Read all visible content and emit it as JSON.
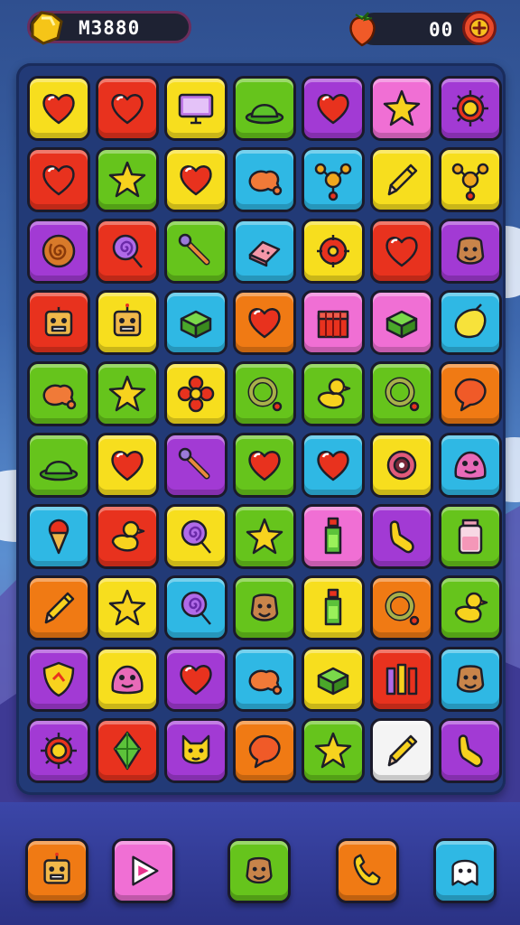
{
  "hud": {
    "score": "M3880",
    "score_icon": "gold-nugget-icon",
    "lives": "00",
    "lives_icon": "strawberry-icon",
    "add_icon": "plus-icon"
  },
  "palette": {
    "Y": "#f7de1e",
    "R": "#e8321e",
    "G": "#66c41c",
    "P": "#a23ad4",
    "K": "#f06fd4",
    "C": "#2fb8e4",
    "O": "#f07a14",
    "W": "#f4f4f4"
  },
  "board": {
    "rows": [
      [
        {
          "c": "Y",
          "icon": "heart"
        },
        {
          "c": "R",
          "icon": "heart"
        },
        {
          "c": "Y",
          "icon": "monitor"
        },
        {
          "c": "G",
          "icon": "bowler-hat"
        },
        {
          "c": "P",
          "icon": "heart"
        },
        {
          "c": "K",
          "icon": "star"
        },
        {
          "c": "P",
          "icon": "sun-badge"
        }
      ],
      [
        {
          "c": "R",
          "icon": "heart"
        },
        {
          "c": "G",
          "icon": "star"
        },
        {
          "c": "Y",
          "icon": "heart"
        },
        {
          "c": "C",
          "icon": "blob"
        },
        {
          "c": "C",
          "icon": "molecule"
        },
        {
          "c": "Y",
          "icon": "pencil"
        },
        {
          "c": "Y",
          "icon": "molecule"
        }
      ],
      [
        {
          "c": "P",
          "icon": "swirl-cookie"
        },
        {
          "c": "R",
          "icon": "lollipop"
        },
        {
          "c": "G",
          "icon": "wand"
        },
        {
          "c": "C",
          "icon": "eraser"
        },
        {
          "c": "Y",
          "icon": "gear"
        },
        {
          "c": "R",
          "icon": "heart"
        },
        {
          "c": "P",
          "icon": "face"
        }
      ],
      [
        {
          "c": "R",
          "icon": "robot"
        },
        {
          "c": "Y",
          "icon": "robot"
        },
        {
          "c": "C",
          "icon": "box"
        },
        {
          "c": "O",
          "icon": "heart"
        },
        {
          "c": "K",
          "icon": "gift"
        },
        {
          "c": "K",
          "icon": "box"
        },
        {
          "c": "C",
          "icon": "lemon"
        }
      ],
      [
        {
          "c": "G",
          "icon": "blob"
        },
        {
          "c": "G",
          "icon": "star"
        },
        {
          "c": "Y",
          "icon": "flower"
        },
        {
          "c": "G",
          "icon": "ring"
        },
        {
          "c": "G",
          "icon": "duck"
        },
        {
          "c": "G",
          "icon": "ring"
        },
        {
          "c": "O",
          "icon": "speech"
        }
      ],
      [
        {
          "c": "G",
          "icon": "bowler-hat"
        },
        {
          "c": "Y",
          "icon": "heart"
        },
        {
          "c": "P",
          "icon": "wand"
        },
        {
          "c": "G",
          "icon": "heart"
        },
        {
          "c": "C",
          "icon": "heart"
        },
        {
          "c": "Y",
          "icon": "camera"
        },
        {
          "c": "C",
          "icon": "monster"
        }
      ],
      [
        {
          "c": "C",
          "icon": "ice-cream"
        },
        {
          "c": "R",
          "icon": "duck"
        },
        {
          "c": "Y",
          "icon": "lollipop"
        },
        {
          "c": "G",
          "icon": "star"
        },
        {
          "c": "K",
          "icon": "bottle"
        },
        {
          "c": "P",
          "icon": "glove"
        },
        {
          "c": "G",
          "icon": "jar"
        }
      ],
      [
        {
          "c": "O",
          "icon": "pencil"
        },
        {
          "c": "Y",
          "icon": "star"
        },
        {
          "c": "C",
          "icon": "lollipop"
        },
        {
          "c": "G",
          "icon": "face"
        },
        {
          "c": "Y",
          "icon": "bottle"
        },
        {
          "c": "O",
          "icon": "ring"
        },
        {
          "c": "G",
          "icon": "duck"
        }
      ],
      [
        {
          "c": "P",
          "icon": "shield"
        },
        {
          "c": "Y",
          "icon": "monster"
        },
        {
          "c": "P",
          "icon": "heart"
        },
        {
          "c": "C",
          "icon": "blob"
        },
        {
          "c": "Y",
          "icon": "box"
        },
        {
          "c": "R",
          "icon": "crayons"
        },
        {
          "c": "C",
          "icon": "face"
        }
      ],
      [
        {
          "c": "P",
          "icon": "sun-badge"
        },
        {
          "c": "R",
          "icon": "gem"
        },
        {
          "c": "P",
          "icon": "cat-face"
        },
        {
          "c": "O",
          "icon": "speech"
        },
        {
          "c": "G",
          "icon": "star"
        },
        {
          "c": "W",
          "icon": "pencil"
        },
        {
          "c": "P",
          "icon": "glove"
        }
      ]
    ]
  },
  "toolbar": [
    {
      "c": "O",
      "icon": "robot"
    },
    {
      "c": "K",
      "icon": "play"
    },
    {
      "c": "G",
      "icon": "face"
    },
    {
      "c": "O",
      "icon": "phone"
    },
    {
      "c": "C",
      "icon": "ghost"
    }
  ]
}
